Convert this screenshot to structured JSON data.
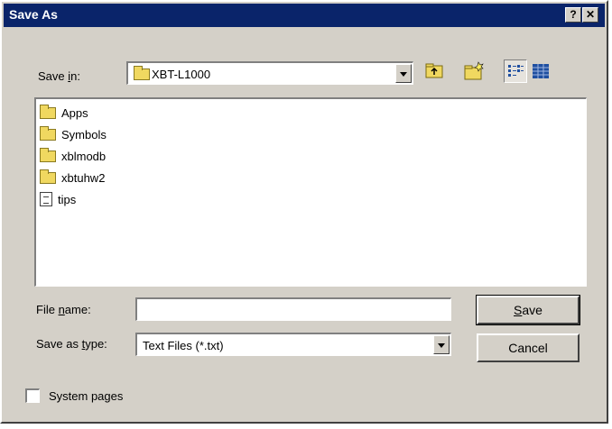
{
  "window": {
    "title": "Save As",
    "help_label": "?",
    "close_label": "✕"
  },
  "save_in": {
    "label_pre": "Save ",
    "label_key": "i",
    "label_post": "n:",
    "value": "XBT-L1000"
  },
  "toolbar": {
    "icons": [
      "up-folder-icon",
      "new-folder-icon",
      "list-view-icon",
      "details-view-icon"
    ]
  },
  "files": [
    {
      "name": "Apps",
      "type": "folder"
    },
    {
      "name": "Symbols",
      "type": "folder"
    },
    {
      "name": "xblmodb",
      "type": "folder"
    },
    {
      "name": "xbtuhw2",
      "type": "folder"
    },
    {
      "name": "tips",
      "type": "file"
    }
  ],
  "file_name": {
    "label_pre": "File ",
    "label_key": "n",
    "label_post": "ame:",
    "value": ""
  },
  "save_as_type": {
    "label_pre": "Save as ",
    "label_key": "t",
    "label_post": "ype:",
    "value": "Text Files (*.txt)"
  },
  "buttons": {
    "save_key": "S",
    "save_rest": "ave",
    "cancel": "Cancel"
  },
  "system_pages": {
    "label": "System pages",
    "checked": false
  }
}
